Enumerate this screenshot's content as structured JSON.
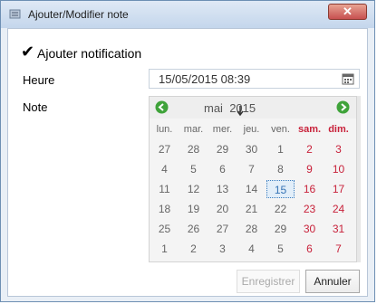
{
  "window": {
    "title": "Ajouter/Modifier note"
  },
  "notification": {
    "checked": true,
    "label": "Ajouter notification"
  },
  "fields": {
    "heure_label": "Heure",
    "heure_value": "15/05/2015 08:39",
    "note_label": "Note"
  },
  "calendar": {
    "month": "mai",
    "year": "2015",
    "weekdays": [
      "lun.",
      "mar.",
      "mer.",
      "jeu.",
      "ven.",
      "sam.",
      "dim."
    ],
    "weeks": [
      [
        "27",
        "28",
        "29",
        "30",
        "1",
        "2",
        "3"
      ],
      [
        "4",
        "5",
        "6",
        "7",
        "8",
        "9",
        "10"
      ],
      [
        "11",
        "12",
        "13",
        "14",
        "15",
        "16",
        "17"
      ],
      [
        "18",
        "19",
        "20",
        "21",
        "22",
        "23",
        "24"
      ],
      [
        "25",
        "26",
        "27",
        "28",
        "29",
        "30",
        "31"
      ],
      [
        "1",
        "2",
        "3",
        "4",
        "5",
        "6",
        "7"
      ]
    ],
    "selected_day": "15",
    "weekend_color": "#c8213a",
    "selected_color": "#3573b5"
  },
  "buttons": {
    "save_label": "Enregistrer",
    "cancel_label": "Annuler"
  },
  "icons": {
    "app": "notebook-icon",
    "close": "close-icon",
    "calendar": "calendar-icon",
    "prev": "arrow-left-icon",
    "next": "arrow-right-icon"
  }
}
